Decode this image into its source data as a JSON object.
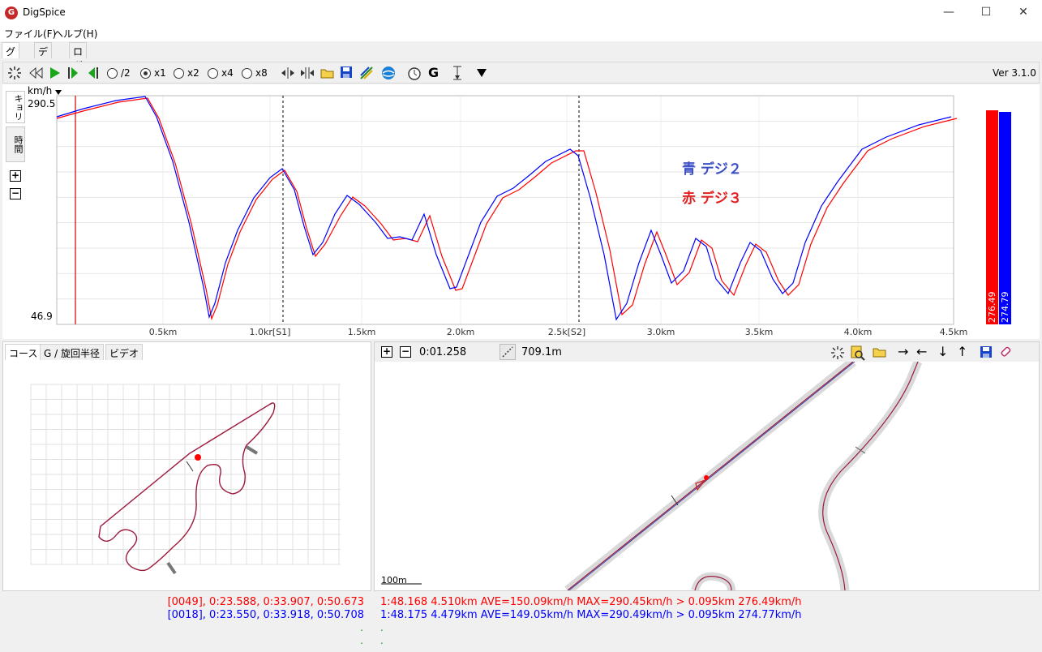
{
  "window": {
    "title": "DigSpice",
    "minimize": "—",
    "maximize": "☐",
    "close": "✕"
  },
  "menu": {
    "file": "ファイル(F)",
    "help": "ヘルプ(H)"
  },
  "main_tabs": [
    "グラフ",
    "データ",
    "ロガー"
  ],
  "toolbar": {
    "speed_options": [
      "/2",
      "x1",
      "x2",
      "x4",
      "x8"
    ],
    "selected_speed": "x1",
    "version": "Ver 3.1.0"
  },
  "graph": {
    "unit": "km/h",
    "y_max": "290.5",
    "y_min": "46.9",
    "vertical_tabs": [
      "キョリ",
      "時間"
    ],
    "x_ticks": [
      "0.5km",
      "1.0kr[S1]",
      "1.5km",
      "2.0km",
      "2.5k[S2]",
      "3.0km",
      "3.5km",
      "4.0km",
      "4.5km"
    ],
    "legend_blue": "青 デジ２",
    "legend_red": "赤 デジ３",
    "bar_red_value": "276.49",
    "bar_blue_value": "274.79",
    "colors": {
      "red": "#ff0000",
      "blue": "#0000ff",
      "legend_blue": "#3b4fc4",
      "legend_red": "#e02020"
    }
  },
  "lower_tabs": [
    "コース",
    "G / 旋回半径",
    "ビデオ"
  ],
  "map_toolbar": {
    "time": "0:01.258",
    "distance": "709.1m",
    "scale_label": "100m"
  },
  "status": {
    "left_red": "[0049], 0:23.588, 0:33.907, 0:50.673",
    "left_blue": "[0018], 0:23.550, 0:33.918, 0:50.708",
    "right_red": "1:48.168 4.510km AVE=150.09km/h MAX=290.45km/h > 0.095km 276.49km/h",
    "right_blue": "1:48.175 4.479km AVE=149.05km/h MAX=290.49km/h > 0.095km 274.77km/h",
    "dot": "."
  }
}
